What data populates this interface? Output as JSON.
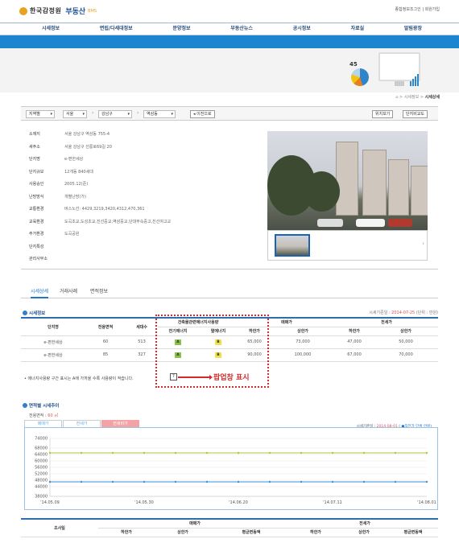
{
  "header": {
    "logo_org": "한국감정원",
    "logo_product": "부동산",
    "logo_badge": "BMS",
    "top_links": "종합정보조그인 | 회원가입"
  },
  "nav": [
    "시세정보",
    "면립/다세대정보",
    "분양정보",
    "부동산뉴스",
    "공시정보",
    "자료실",
    "알림광장"
  ],
  "hero": {
    "pie_label": "45"
  },
  "breadcrumb": {
    "prefix": "⌂ > 시세정보 >",
    "current": "시세상세"
  },
  "filter": {
    "region1": "지역별",
    "region2": "서울",
    "region3": "강남구",
    "region4": "역삼동",
    "prev_button": "◂ 이전으로",
    "location_button": "위치보기",
    "complex_compare_button": "단지비교도"
  },
  "info": [
    {
      "label": "소재지",
      "value": "서울 강남구 역삼동 755-4"
    },
    {
      "label": "새주소",
      "value": "서울 강남구 선릉로69길 20"
    },
    {
      "label": "단지명",
      "value": "e-편한세상"
    },
    {
      "label": "단지규모",
      "value": "12개동 840세대"
    },
    {
      "label": "사용승인",
      "value": "2005.12(준)"
    },
    {
      "label": "난방방식",
      "value": "개별난방(가)"
    },
    {
      "label": "교통환경",
      "value": "버스노선: 4429,3219,3420,4312,470,361"
    },
    {
      "label": "교육환경",
      "value": "도곡초교,도성초교,진선중교,역삼중교,단대부속중고,진선여고교"
    },
    {
      "label": "주거환경",
      "value": "도곡공원"
    },
    {
      "label": "단지특성",
      "value": ""
    },
    {
      "label": "관리사무소",
      "value": ""
    }
  ],
  "tabs": [
    "시세상세",
    "거래사례",
    "면적정보"
  ],
  "price_section": {
    "title": "시세정보",
    "base_date_label": "시세기준일 :",
    "base_date": "2014-07-25",
    "unit": "(단위 : 만원)",
    "headers": {
      "complex": "단지명",
      "area": "전용면적",
      "households": "세대수",
      "energy": "건축물관련에너지사용량",
      "electric": "전기에너지",
      "heat": "열에너지",
      "sale": "매매가",
      "jeonse": "전세가",
      "low": "하한가",
      "high": "상한가"
    },
    "rows": [
      {
        "name": "e-편한세상",
        "area": "60",
        "households": "513",
        "electric": "A",
        "heat": "B",
        "sale_low": "65,000",
        "sale_high": "73,000",
        "jeonse_low": "47,000",
        "jeonse_high": "50,000"
      },
      {
        "name": "e-편한세상",
        "area": "85",
        "households": "327",
        "electric": "A",
        "heat": "B",
        "sale_low": "90,000",
        "sale_high": "100,000",
        "jeonse_low": "67,000",
        "jeonse_high": "70,000"
      }
    ],
    "note": "에너지사용량 구간 표시는 A에 가까울 수록 사용량이 적습니다.",
    "note_icon": "?",
    "popup_label": "팝업창 표시"
  },
  "chart_section": {
    "title": "면적별 시세추이",
    "area_label": "전용면적 :",
    "area_value": "60 ㎡",
    "tabs": [
      "매매가",
      "전세가",
      "전세비가"
    ],
    "info_prefix": "시세기준일 :",
    "info_date": "2014-08-01",
    "info_suffix": "(",
    "info_unit": "●직전가 단위 만원)"
  },
  "chart_data": {
    "type": "line",
    "x": [
      "'14.05.09",
      "'14.05.16",
      "'14.05.23",
      "'14.05.30",
      "'14.06.06",
      "'14.06.13",
      "'14.06.20",
      "'14.06.27",
      "'14.07.04",
      "'14.07.11",
      "'14.07.18",
      "'14.07.25",
      "'14.08.01"
    ],
    "x_tick_labels": [
      "'14.05.09",
      "'14.05.30",
      "'14.06.20",
      "'14.07.11",
      "'14.08.01"
    ],
    "ylim": [
      38000,
      74000
    ],
    "yticks": [
      74000,
      68000,
      64000,
      60000,
      56000,
      52000,
      48000,
      44000,
      38000
    ],
    "series": [
      {
        "color": "#a9c93a",
        "values": [
          65000,
          65000,
          65000,
          65000,
          65000,
          65000,
          65000,
          65000,
          65000,
          65000,
          65000,
          65000,
          65000
        ]
      },
      {
        "color": "#3b8fd6",
        "values": [
          47000,
          47000,
          47000,
          47000,
          47000,
          47000,
          47000,
          47000,
          47000,
          47000,
          47000,
          47000,
          47000
        ]
      }
    ],
    "grid": true
  },
  "bottom_table": {
    "survey": "조사일",
    "sale": "매매가",
    "jeonse": "전세가",
    "low": "하한가",
    "high": "상한가",
    "avg": "평균변동액"
  }
}
